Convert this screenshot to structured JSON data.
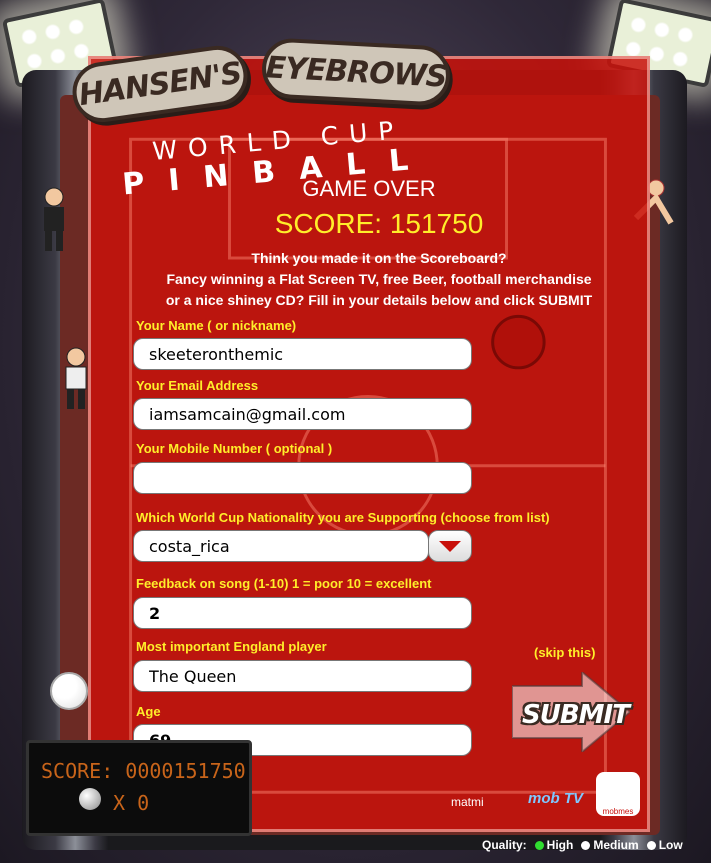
{
  "logo": {
    "name_line1": "HANSEN'S",
    "name_line2": "EYEBROWS",
    "subtitle": "WORLD CUP",
    "title": "PINBALL"
  },
  "game_over": {
    "title": "GAME OVER",
    "score_label": "SCORE: 151750"
  },
  "intro": {
    "line1": "Think you made it on the Scoreboard?",
    "line2": "Fancy winning a Flat Screen TV, free Beer, football merchandise",
    "line3": "or a nice shiney CD? Fill in your details below and click SUBMIT"
  },
  "form": {
    "name_label": "Your Name ( or nickname)",
    "name_value": "skeeteronthemic",
    "email_label": "Your Email Address",
    "email_value": "iamsamcain@gmail.com",
    "mobile_label": "Your Mobile Number ( optional )",
    "mobile_value": "",
    "nationality_label": "Which World Cup Nationality you are Supporting (choose from list)",
    "nationality_value": "costa_rica",
    "feedback_label": "Feedback on song (1-10)  1 = poor 10 = excellent",
    "feedback_value": "2",
    "player_label": "Most important England player",
    "player_value": "The Queen",
    "skip_label": "(skip this)",
    "age_label": "Age",
    "age_value": "69",
    "submit_label": "SUBMIT"
  },
  "scoreboard": {
    "score_text": "SCORE: 0000151750",
    "balls_text": "X 0"
  },
  "brands": {
    "matmi": "matmi",
    "mob": "mob TV",
    "mobmes": "mobmes"
  },
  "quality": {
    "label": "Quality:",
    "options": [
      "High",
      "Medium",
      "Low"
    ],
    "selected": "High"
  },
  "colors": {
    "panel": "#c8120a",
    "label_yellow": "#ffee2a",
    "score_yellow": "#ffee2a",
    "quality_active": "#30dd30"
  }
}
